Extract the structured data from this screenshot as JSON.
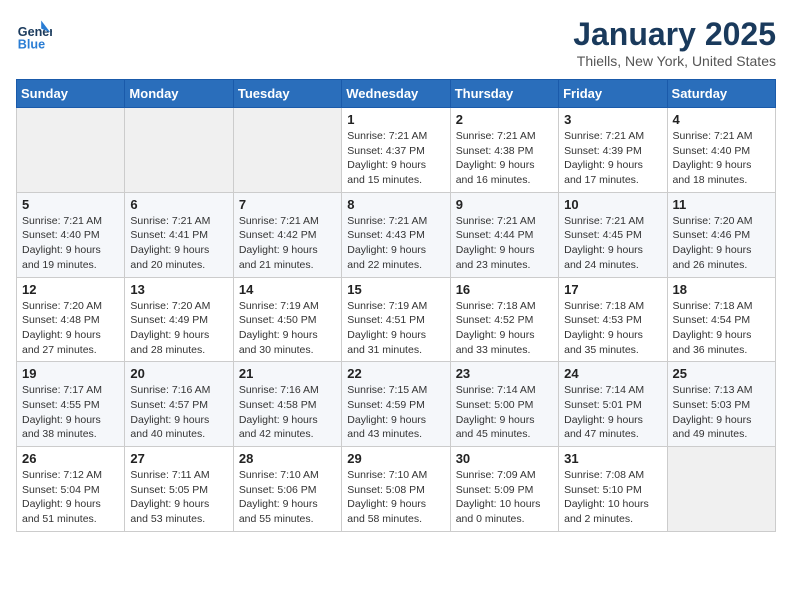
{
  "logo": {
    "line1": "General",
    "line2": "Blue"
  },
  "title": "January 2025",
  "location": "Thiells, New York, United States",
  "days_header": [
    "Sunday",
    "Monday",
    "Tuesday",
    "Wednesday",
    "Thursday",
    "Friday",
    "Saturday"
  ],
  "weeks": [
    [
      {
        "day": "",
        "info": ""
      },
      {
        "day": "",
        "info": ""
      },
      {
        "day": "",
        "info": ""
      },
      {
        "day": "1",
        "info": "Sunrise: 7:21 AM\nSunset: 4:37 PM\nDaylight: 9 hours\nand 15 minutes."
      },
      {
        "day": "2",
        "info": "Sunrise: 7:21 AM\nSunset: 4:38 PM\nDaylight: 9 hours\nand 16 minutes."
      },
      {
        "day": "3",
        "info": "Sunrise: 7:21 AM\nSunset: 4:39 PM\nDaylight: 9 hours\nand 17 minutes."
      },
      {
        "day": "4",
        "info": "Sunrise: 7:21 AM\nSunset: 4:40 PM\nDaylight: 9 hours\nand 18 minutes."
      }
    ],
    [
      {
        "day": "5",
        "info": "Sunrise: 7:21 AM\nSunset: 4:40 PM\nDaylight: 9 hours\nand 19 minutes."
      },
      {
        "day": "6",
        "info": "Sunrise: 7:21 AM\nSunset: 4:41 PM\nDaylight: 9 hours\nand 20 minutes."
      },
      {
        "day": "7",
        "info": "Sunrise: 7:21 AM\nSunset: 4:42 PM\nDaylight: 9 hours\nand 21 minutes."
      },
      {
        "day": "8",
        "info": "Sunrise: 7:21 AM\nSunset: 4:43 PM\nDaylight: 9 hours\nand 22 minutes."
      },
      {
        "day": "9",
        "info": "Sunrise: 7:21 AM\nSunset: 4:44 PM\nDaylight: 9 hours\nand 23 minutes."
      },
      {
        "day": "10",
        "info": "Sunrise: 7:21 AM\nSunset: 4:45 PM\nDaylight: 9 hours\nand 24 minutes."
      },
      {
        "day": "11",
        "info": "Sunrise: 7:20 AM\nSunset: 4:46 PM\nDaylight: 9 hours\nand 26 minutes."
      }
    ],
    [
      {
        "day": "12",
        "info": "Sunrise: 7:20 AM\nSunset: 4:48 PM\nDaylight: 9 hours\nand 27 minutes."
      },
      {
        "day": "13",
        "info": "Sunrise: 7:20 AM\nSunset: 4:49 PM\nDaylight: 9 hours\nand 28 minutes."
      },
      {
        "day": "14",
        "info": "Sunrise: 7:19 AM\nSunset: 4:50 PM\nDaylight: 9 hours\nand 30 minutes."
      },
      {
        "day": "15",
        "info": "Sunrise: 7:19 AM\nSunset: 4:51 PM\nDaylight: 9 hours\nand 31 minutes."
      },
      {
        "day": "16",
        "info": "Sunrise: 7:18 AM\nSunset: 4:52 PM\nDaylight: 9 hours\nand 33 minutes."
      },
      {
        "day": "17",
        "info": "Sunrise: 7:18 AM\nSunset: 4:53 PM\nDaylight: 9 hours\nand 35 minutes."
      },
      {
        "day": "18",
        "info": "Sunrise: 7:18 AM\nSunset: 4:54 PM\nDaylight: 9 hours\nand 36 minutes."
      }
    ],
    [
      {
        "day": "19",
        "info": "Sunrise: 7:17 AM\nSunset: 4:55 PM\nDaylight: 9 hours\nand 38 minutes."
      },
      {
        "day": "20",
        "info": "Sunrise: 7:16 AM\nSunset: 4:57 PM\nDaylight: 9 hours\nand 40 minutes."
      },
      {
        "day": "21",
        "info": "Sunrise: 7:16 AM\nSunset: 4:58 PM\nDaylight: 9 hours\nand 42 minutes."
      },
      {
        "day": "22",
        "info": "Sunrise: 7:15 AM\nSunset: 4:59 PM\nDaylight: 9 hours\nand 43 minutes."
      },
      {
        "day": "23",
        "info": "Sunrise: 7:14 AM\nSunset: 5:00 PM\nDaylight: 9 hours\nand 45 minutes."
      },
      {
        "day": "24",
        "info": "Sunrise: 7:14 AM\nSunset: 5:01 PM\nDaylight: 9 hours\nand 47 minutes."
      },
      {
        "day": "25",
        "info": "Sunrise: 7:13 AM\nSunset: 5:03 PM\nDaylight: 9 hours\nand 49 minutes."
      }
    ],
    [
      {
        "day": "26",
        "info": "Sunrise: 7:12 AM\nSunset: 5:04 PM\nDaylight: 9 hours\nand 51 minutes."
      },
      {
        "day": "27",
        "info": "Sunrise: 7:11 AM\nSunset: 5:05 PM\nDaylight: 9 hours\nand 53 minutes."
      },
      {
        "day": "28",
        "info": "Sunrise: 7:10 AM\nSunset: 5:06 PM\nDaylight: 9 hours\nand 55 minutes."
      },
      {
        "day": "29",
        "info": "Sunrise: 7:10 AM\nSunset: 5:08 PM\nDaylight: 9 hours\nand 58 minutes."
      },
      {
        "day": "30",
        "info": "Sunrise: 7:09 AM\nSunset: 5:09 PM\nDaylight: 10 hours\nand 0 minutes."
      },
      {
        "day": "31",
        "info": "Sunrise: 7:08 AM\nSunset: 5:10 PM\nDaylight: 10 hours\nand 2 minutes."
      },
      {
        "day": "",
        "info": ""
      }
    ]
  ]
}
